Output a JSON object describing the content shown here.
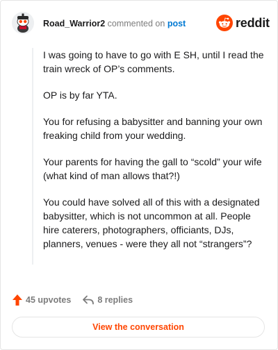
{
  "header": {
    "username": "Road_Warrior2",
    "action_text": "commented on",
    "post_link": "post",
    "brand": "reddit"
  },
  "comment": {
    "paragraphs": [
      "I was going to have to go with E SH, until I read the train wreck of OP’s comments.",
      "OP is by far YTA.",
      "You for refusing a babysitter and banning your own freaking child from your wedding.",
      "Your parents for having the gall to “scold” your wife (what kind of man allows that?!)",
      "You could have solved all of this with a designated babysitter, which is not uncommon at all. People hire caterers, photographers, officiants, DJs, planners, venues - were they all not “strangers”?"
    ]
  },
  "actions": {
    "upvotes": "45 upvotes",
    "replies": "8 replies"
  },
  "footer": {
    "view_button": "View the conversation"
  },
  "colors": {
    "accent": "#ff4500",
    "link": "#0079d3",
    "muted": "#7c7c7c"
  },
  "icons": {
    "avatar": "snoo-avatar-icon",
    "logo": "reddit-snoo-icon",
    "upvote": "upvote-arrow-icon",
    "reply": "reply-arrow-icon"
  }
}
